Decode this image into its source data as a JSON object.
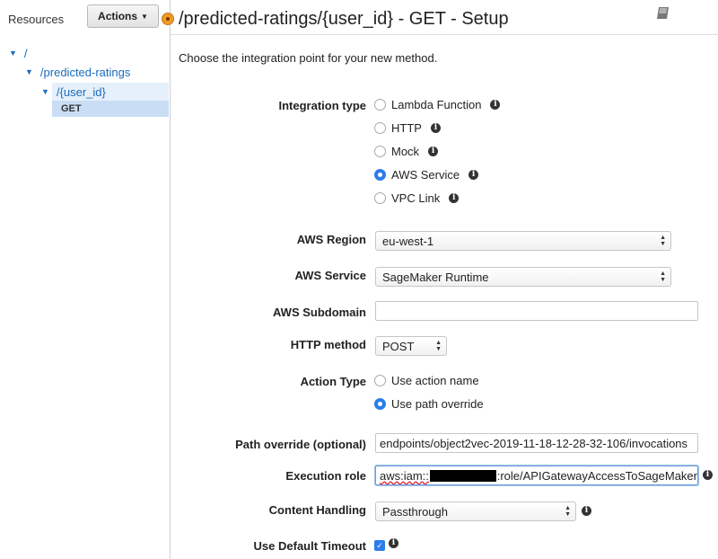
{
  "sidebar": {
    "title": "Resources",
    "actions_label": "Actions",
    "tree": {
      "root": "/",
      "predicted": "/predicted-ratings",
      "user_id": "/{user_id}",
      "get": "GET"
    }
  },
  "header": {
    "title": "/predicted-ratings/{user_id} - GET - Setup"
  },
  "main": {
    "intro": "Choose the integration point for your new method.",
    "integration_type": {
      "label": "Integration type",
      "options": [
        "Lambda Function",
        "HTTP",
        "Mock",
        "AWS Service",
        "VPC Link"
      ],
      "selected": "AWS Service"
    },
    "aws_region": {
      "label": "AWS Region",
      "value": "eu-west-1"
    },
    "aws_service": {
      "label": "AWS Service",
      "value": "SageMaker Runtime"
    },
    "aws_subdomain": {
      "label": "AWS Subdomain",
      "value": ""
    },
    "http_method": {
      "label": "HTTP method",
      "value": "POST"
    },
    "action_type": {
      "label": "Action Type",
      "options": [
        "Use action name",
        "Use path override"
      ],
      "selected": "Use path override"
    },
    "path_override": {
      "label": "Path override (optional)",
      "value": "endpoints/object2vec-2019-11-18-12-28-32-106/invocations"
    },
    "execution_role": {
      "label": "Execution role",
      "prefix": "aws:iam::",
      "suffix": ":role/APIGatewayAccessToSageMaker"
    },
    "content_handling": {
      "label": "Content Handling",
      "value": "Passthrough"
    },
    "default_timeout": {
      "label": "Use Default Timeout",
      "checked": true
    }
  },
  "colors": {
    "link": "#1a6bbd",
    "selected_radio": "#2b7de9",
    "tree_highlight": "#c9def5",
    "orange_indicator": "#f09b2a"
  },
  "icons": {
    "info": "info-icon",
    "docs": "book-icon",
    "tree_expand": "triangle-down-icon"
  }
}
